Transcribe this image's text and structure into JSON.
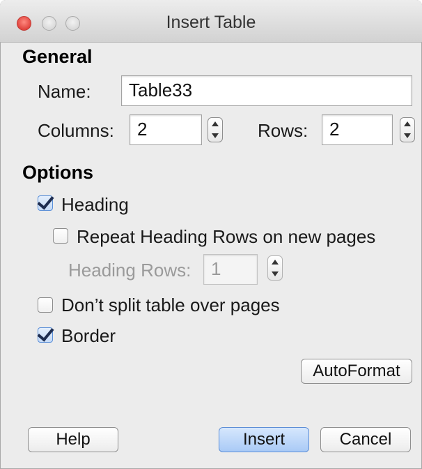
{
  "window": {
    "title": "Insert Table"
  },
  "general": {
    "heading": "General",
    "name_label": "Name:",
    "name_value": "Table33",
    "columns_label": "Columns:",
    "columns_value": "2",
    "rows_label": "Rows:",
    "rows_value": "2"
  },
  "options": {
    "heading": "Options",
    "heading_checkbox": {
      "label": "Heading",
      "checked": true
    },
    "repeat_heading": {
      "label": "Repeat Heading Rows on new pages",
      "checked": false
    },
    "heading_rows_label": "Heading Rows:",
    "heading_rows_value": "1",
    "dont_split": {
      "label": "Don’t split table over pages",
      "checked": false
    },
    "border": {
      "label": "Border",
      "checked": true
    },
    "autoformat_label": "AutoFormat"
  },
  "buttons": {
    "help": "Help",
    "insert": "Insert",
    "cancel": "Cancel"
  }
}
